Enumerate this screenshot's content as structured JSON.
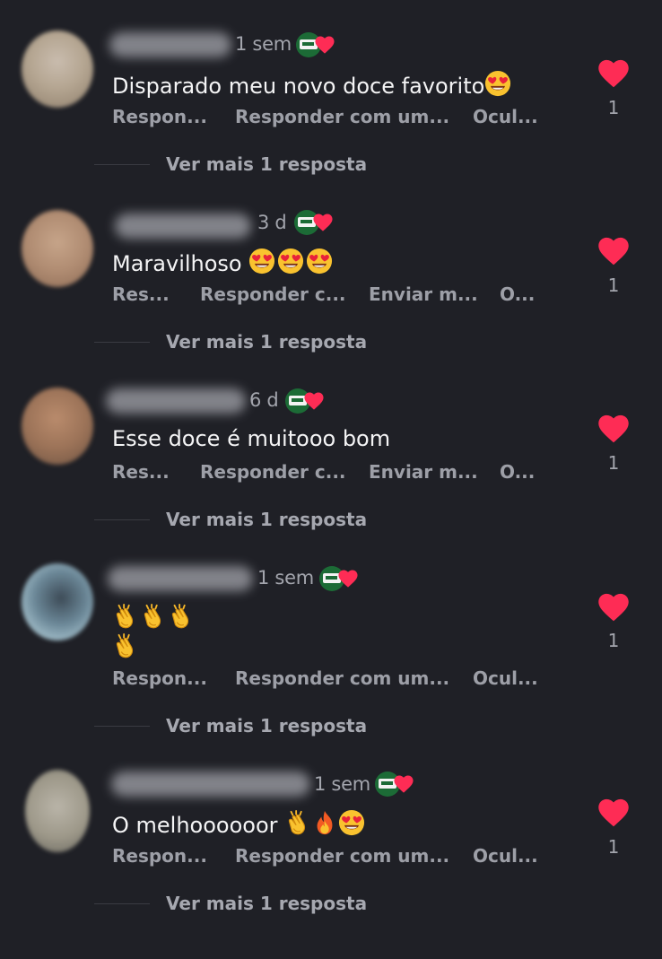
{
  "colors": {
    "background": "#1f2026",
    "text": "#f4f4f5",
    "secondary": "#9d9fa7",
    "like": "#fe2c55",
    "badge": "#1c6b36"
  },
  "comments": [
    {
      "time": "1 sem",
      "text": "Disparado meu novo doce favorito",
      "actions": [
        "Respon...",
        "Responder com um...",
        "Ocul..."
      ],
      "more_replies": "Ver mais 1 resposta",
      "likes": "1"
    },
    {
      "time": "3 d",
      "text": "Maravilhoso",
      "actions": [
        "Res...",
        "Responder c...",
        "Enviar m...",
        "O..."
      ],
      "more_replies": "Ver mais 1 resposta",
      "likes": "1"
    },
    {
      "time": "6 d",
      "text": "Esse doce é muitooo bom",
      "actions": [
        "Res...",
        "Responder c...",
        "Enviar m...",
        "O..."
      ],
      "more_replies": "Ver mais 1 resposta",
      "likes": "1"
    },
    {
      "time": "1 sem",
      "text": "",
      "actions": [
        "Respon...",
        "Responder com um...",
        "Ocul..."
      ],
      "more_replies": "Ver mais 1 resposta",
      "likes": "1"
    },
    {
      "time": "1 sem",
      "text": "O melhoooooor",
      "actions": [
        "Respon...",
        "Responder com um...",
        "Ocul..."
      ],
      "more_replies": "Ver mais 1 resposta",
      "likes": "1"
    }
  ]
}
